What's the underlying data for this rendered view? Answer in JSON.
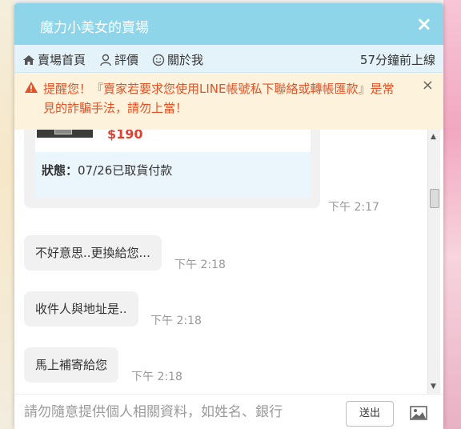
{
  "header": {
    "title": "魔力小美女的賣場",
    "close_label": "×"
  },
  "nav": {
    "store_home": "賣場首頁",
    "ratings": "評價",
    "about": "關於我",
    "last_online": "57分鐘前上線"
  },
  "warning": {
    "text_line1": "提醒您！『賣家若要求您使用LINE帳號私下聯絡或轉帳匯款』是常",
    "text_line2": "見的詐騙手法，請勿上當！",
    "close_label": "×"
  },
  "order_card": {
    "price": "$190",
    "status_label": "狀態：",
    "status_value": "07/26已取貨付款",
    "time": "下午 2:17"
  },
  "messages": [
    {
      "text": "不好意思..更換給您...",
      "time": "下午 2:18"
    },
    {
      "text": "收件人與地址是..",
      "time": "下午 2:18"
    },
    {
      "text": "馬上補寄給您",
      "time": "下午 2:18"
    }
  ],
  "composer": {
    "placeholder": "請勿隨意提供個人相關資料，如姓名、銀行",
    "send_label": "送出"
  },
  "colors": {
    "header_bg": "#8fd5ea",
    "warning_text": "#e0542a",
    "price": "#e53e2e"
  }
}
